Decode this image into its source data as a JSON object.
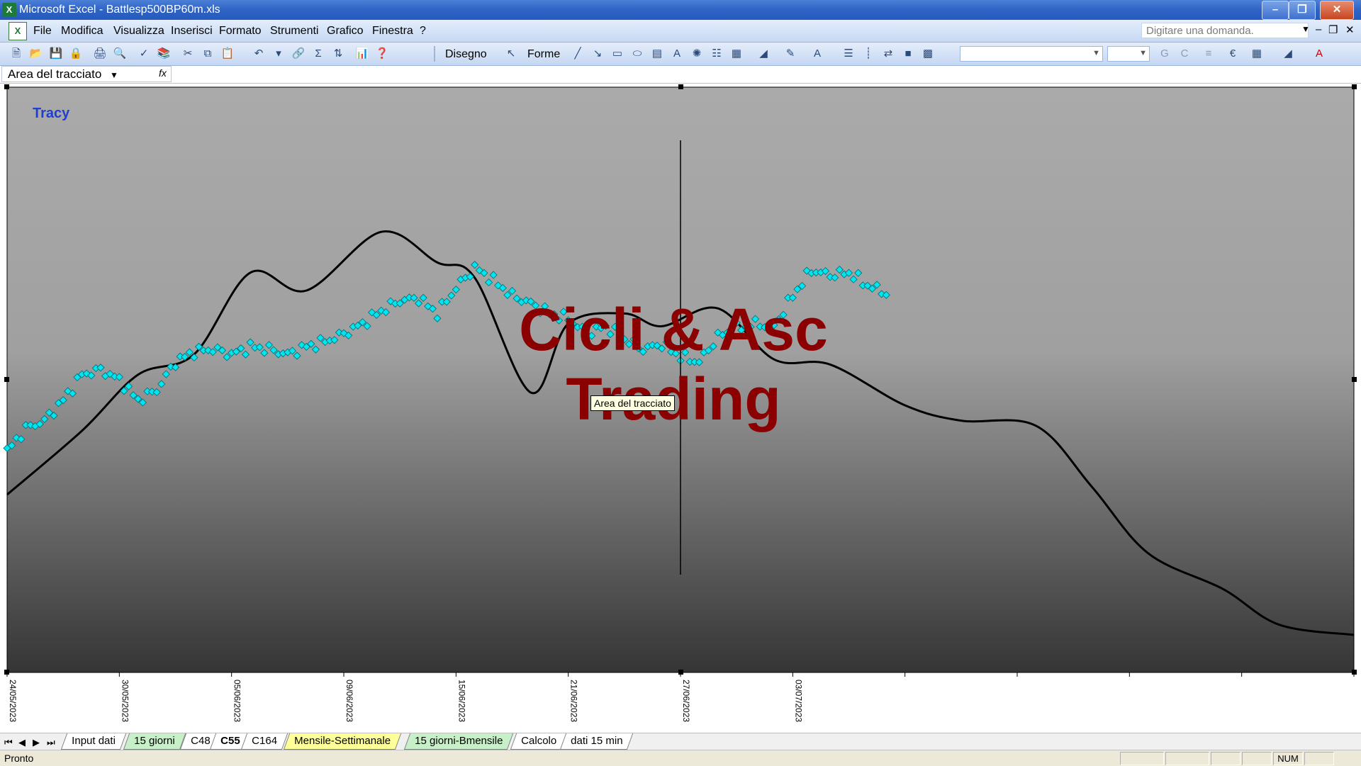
{
  "window": {
    "title": "Microsoft Excel - Battlesp500BP60m.xls"
  },
  "menu": {
    "items": [
      "File",
      "Modifica",
      "Visualizza",
      "Inserisci",
      "Formato",
      "Strumenti",
      "Grafico",
      "Finestra",
      "?"
    ],
    "ask_placeholder": "Digitare una domanda."
  },
  "toolbar": {
    "draw_label": "Disegno",
    "shapes_label": "Forme",
    "bold_label": "G",
    "italic_label": "C"
  },
  "namebox": {
    "value": "Area del tracciato",
    "fx": "fx"
  },
  "chart": {
    "legend_label": "Tracy",
    "watermark_line1": "Cicli & Asc",
    "watermark_line2": "Trading",
    "tooltip": "Area del tracciato",
    "colors": {
      "plot_top": "#a9a9a9",
      "plot_bottom": "#3a3a3a",
      "price_line": "#00e5f0",
      "cycle_line": "#000000",
      "watermark": "#8b0000",
      "legend": "#2040d0"
    }
  },
  "chart_data": {
    "type": "line",
    "title": "",
    "x_tick_labels": [
      "24/05/2023",
      "30/05/2023",
      "05/06/2023",
      "09/06/2023",
      "15/06/2023",
      "21/06/2023",
      "27/06/2023",
      "03/07/2023"
    ],
    "y_axis": "none (no labels printed)",
    "grid": false,
    "series": [
      {
        "name": "Tracy",
        "style": "cyan diamond markers",
        "x": [
          0,
          10,
          20,
          30,
          40,
          50,
          60,
          70,
          80,
          90,
          100,
          110,
          120,
          130,
          140,
          150,
          160,
          170,
          180,
          190,
          200,
          210,
          220,
          230,
          240,
          250,
          260,
          270,
          280,
          290,
          300,
          310,
          320,
          330,
          340,
          350,
          360,
          370,
          380,
          390,
          400,
          410,
          420,
          430,
          440,
          450,
          460,
          470
        ],
        "y": [
          -0.28,
          -0.19,
          -0.16,
          -0.08,
          0.02,
          0.04,
          0.0,
          -0.08,
          -0.04,
          0.07,
          0.11,
          0.12,
          0.1,
          0.13,
          0.12,
          0.1,
          0.13,
          0.15,
          0.18,
          0.22,
          0.27,
          0.31,
          0.32,
          0.26,
          0.36,
          0.44,
          0.39,
          0.33,
          0.3,
          0.26,
          0.24,
          0.18,
          0.21,
          0.16,
          0.12,
          0.14,
          0.09,
          0.07,
          0.17,
          0.2,
          0.22,
          0.21,
          0.33,
          0.43,
          0.41,
          0.42,
          0.37,
          0.34
        ],
        "x_unit": "hours of 60m bars from 24/05/2023"
      },
      {
        "name": "",
        "style": "black smooth cycle line",
        "x": [
          0,
          40,
          70,
          100,
          130,
          160,
          200,
          230,
          250,
          280,
          300,
          330,
          350,
          380,
          410,
          440,
          480,
          510,
          550,
          580,
          610,
          650,
          680,
          720
        ],
        "y": [
          -0.45,
          -0.2,
          0.02,
          0.1,
          0.42,
          0.35,
          0.58,
          0.46,
          0.4,
          -0.05,
          0.22,
          0.26,
          0.21,
          0.28,
          0.08,
          0.06,
          -0.1,
          -0.16,
          -0.18,
          -0.42,
          -0.68,
          -0.82,
          -0.96,
          -1.0
        ]
      }
    ],
    "annotation": "vertical line at 27/06/2023"
  },
  "sheet_tabs": {
    "tabs": [
      "Input dati",
      "15 giorni",
      "C48",
      "C55",
      "C164",
      "Mensile-Settimanale",
      "15 giorni-Bmensile",
      "Calcolo",
      "dati 15 min"
    ],
    "active": "C55",
    "tab_colors": [
      "#ffffff",
      "#c8f0c8",
      "#ffffff",
      "#ffffff",
      "#ffffff",
      "#ffff99",
      "#c8f0c8",
      "#ffffff",
      "#ffffff"
    ]
  },
  "status": {
    "ready": "Pronto",
    "num": "NUM"
  }
}
